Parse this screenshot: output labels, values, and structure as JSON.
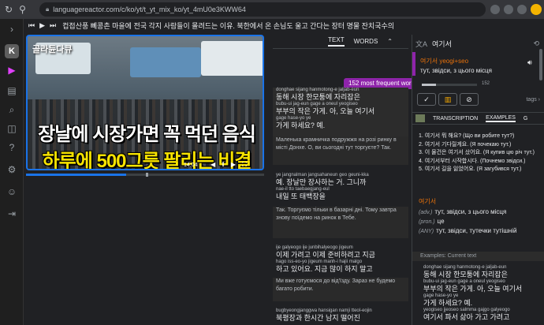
{
  "browser": {
    "url": "languagereactor.com/c/ko/yt/t_yt_mix_ko/yt_4mU0e3KWW64"
  },
  "sidebar": {
    "logo_letter": "K"
  },
  "player": {
    "title": "컵접산풍 뻬콩촌 마을에 전국 각지 사람들이 몰려드는 이유. 북한에서 온 손님도 울고 간다는 장터 명물 잔치국수의 기막힌 추억의 맛 | 한국기행 전통시장 | #...",
    "progress": 0.42
  },
  "video": {
    "channel_tag": "골라듄다큐",
    "caption_line1": "장날에 시장가면 꼭 먹던 음식",
    "caption_line2": "하루에 500그릇 팔리는 비결",
    "time": "14:04"
  },
  "subtitles": {
    "tab_text": "TEXT",
    "tab_words": "WORDS",
    "tooltip": "152 most frequent word",
    "blocks": [
      {
        "rom1": "donghae  sijang  hanmotong-e  jaljab-eun",
        "kr1": "동해    시장    한모퉁에    자리잡은",
        "rom2": "bubu-ui  jag-eun  gage  a  oneul  yeogiseo",
        "kr2": "부부의  작은  가게. 아, 오늘  여기서",
        "rom3": "gage  hase-yo  ye",
        "kr3": "가게  하세요? 예.",
        "tr": "Маленька крамничка подружжя на розі ринку в місті Донхе. О, ви сьогодні тут торгуєте? Так."
      },
      {
        "rom1": "ye  jangnalman  jangsahaneun  geo  geuni-kka",
        "kr1": "예.  장날만    장사하는    거.  그니까",
        "rom2": "nae-il  tto  taebaegjang-eul",
        "kr2": "내일  또    태백장을",
        "tr": "Так. Торгуємо тільки в базарні дні. Тому завтра знову поїдемо на ринок в Тебе."
      },
      {
        "rom1": "ije  galyeogo  ije  junbihalyeogo  jigeum",
        "kr1": "이제  가려고  이제  준비하려고  지금",
        "rom2": "hago  iss-eo-yo  jigeum  manh-i  hajii  malgo",
        "kr2": "하고  있어요.  지금  많이  하지  말고",
        "tr": "Ми вже готуємося до від'їзду. Зараз не будемо багато робити."
      },
      {
        "rom1": "bugbyeongjanggwa  hansigan  namji  tteol-eojin",
        "kr1": "북평장과      한시간  남지  떨어진"
      }
    ]
  },
  "dictionary": {
    "search_word": "여기서",
    "word": "여기서",
    "romanization": "yeogi+seo",
    "translation": "тут, звідси, з цього місця",
    "frequency_rank": "152",
    "frequency_fill": 0.25,
    "tags_label": "tags",
    "tabs": [
      "TRANSCRIPTION",
      "EXAMPLES",
      "G"
    ],
    "examples": [
      "1. 여기서 뭐 해요? (Що ви робите тут?)",
      "2. 여기서 기다릴게요. (Я почекаю тут.)",
      "3. 이 물건은 여기서 샀어요. (Я купив цю річ тут.)",
      "4. 여기서부터 시작합시다. (Почнемо звідси.)",
      "5. 여기서 길을 잃었어요. (Я загубився тут.)"
    ],
    "section_word": "여기서",
    "definitions": [
      {
        "pos": "(adv.)",
        "text": "тут, звідси, з цього місця"
      },
      {
        "pos": "(pron.)",
        "text": "це"
      },
      {
        "pos": "(ANY)",
        "text": "тут, звідси, тутечки тутішній"
      }
    ],
    "current_text_header": "Examples: Current text",
    "current_text": {
      "rom1": "donghae  sijang  hanmotong-e  jaljab-eun",
      "kr1": "동해   시장   한모퉁에   자리잡은",
      "rom2": "bubu-ui  jag-eun  gage  a  oneul  yeogiseo",
      "kr2": "부부의  작은  가게. 아, 오늘  여기서",
      "rom3": "gage  hase-yo  ye",
      "kr3": "가게  하세요? 예.",
      "rom4": "yeogiseo  jjeoseo  salmma  gajgo  galyeogo",
      "kr4": "여기서   파서   삶아  가고  가려고"
    }
  }
}
